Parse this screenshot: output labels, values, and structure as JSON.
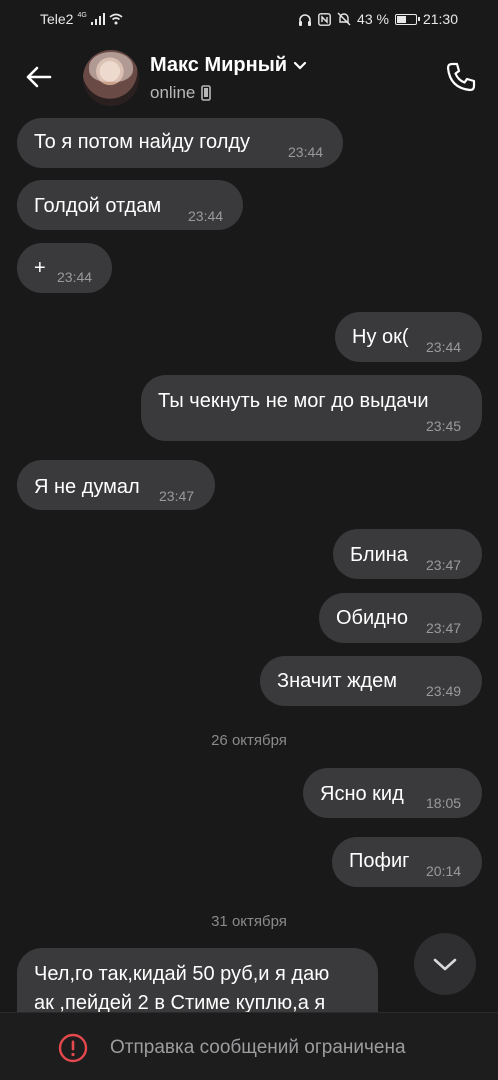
{
  "status_bar": {
    "carrier": "Tele2",
    "network": "4G",
    "battery": "43 %",
    "battery_level": 0.43,
    "time": "21:30"
  },
  "header": {
    "contact_name": "Макс Мирный",
    "status": "online"
  },
  "messages": [
    {
      "side": "in",
      "text": "То я потом найду голду",
      "time": "23:44"
    },
    {
      "side": "in",
      "text": "Голдой отдам",
      "time": "23:44"
    },
    {
      "side": "in",
      "text": "+",
      "time": "23:44"
    },
    {
      "side": "out",
      "text": "Ну ок(",
      "time": "23:44"
    },
    {
      "side": "out",
      "text": "Ты чекнуть не мог до выдачи",
      "time": "23:45"
    },
    {
      "side": "in",
      "text": "Я не думал",
      "time": "23:47"
    },
    {
      "side": "out",
      "text": "Блина",
      "time": "23:47"
    },
    {
      "side": "out",
      "text": "Обидно",
      "time": "23:47"
    },
    {
      "side": "out",
      "text": "Значит ждем",
      "time": "23:49"
    },
    {
      "side": "out",
      "text": "Ясно кид",
      "time": "18:05"
    },
    {
      "side": "out",
      "text": "Пофиг",
      "time": "20:14"
    },
    {
      "side": "in",
      "text_lines": [
        "Чел,го так,кидай 50 руб,и я даю",
        "ак ,пейдей 2 в Стиме куплю,а я"
      ]
    }
  ],
  "date_separators": [
    "26 октября",
    "31 октября"
  ],
  "bottom": {
    "restriction_text": "Отправка сообщений ограничена"
  },
  "icons": {
    "back": "arrow-left-icon",
    "expand": "chevron-down-icon",
    "device": "mobile-device-icon",
    "call": "phone-icon",
    "scroll": "chevron-down-icon",
    "warning": "exclamation-circle-icon"
  },
  "colors": {
    "background": "#19191a",
    "bubble": "#3a3a3c",
    "warning": "#e5484d"
  }
}
